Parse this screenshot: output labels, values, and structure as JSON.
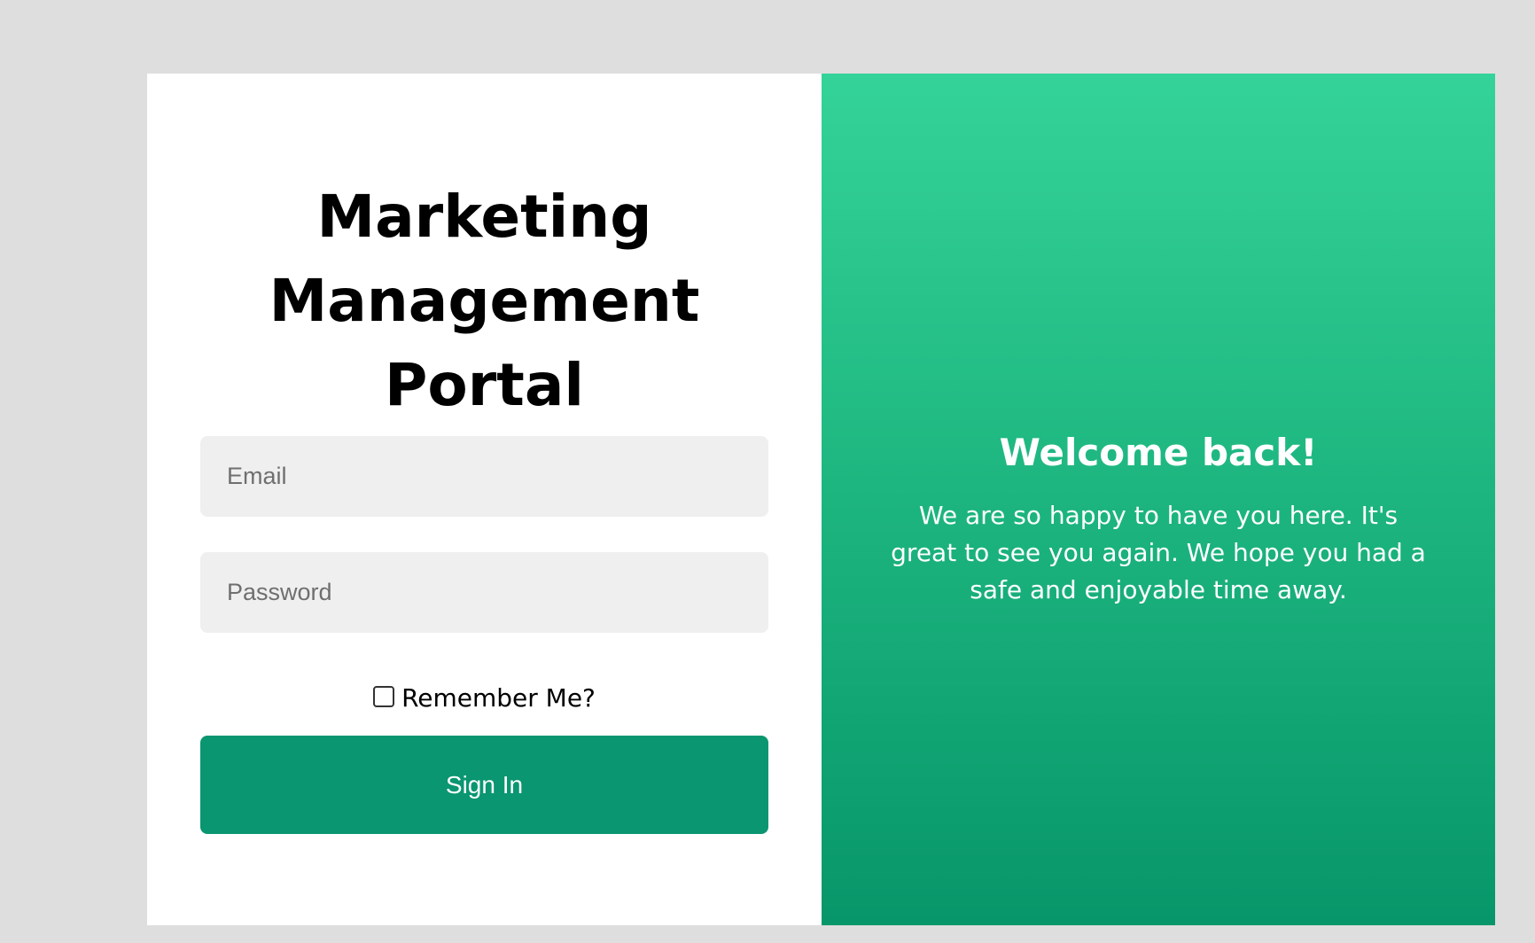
{
  "login": {
    "title_lines": [
      "Marketing",
      "Management",
      "Portal"
    ],
    "email_placeholder": "Email",
    "password_placeholder": "Password",
    "remember_label": "Remember Me?",
    "remember_checked": false,
    "signin_label": "Sign In"
  },
  "welcome_panel": {
    "heading": "Welcome back!",
    "message": "We are so happy to have you here. It's great to see you again. We hope you had a safe and enjoyable time away."
  },
  "colors": {
    "page_background": "#dedede",
    "button": "#099670",
    "panel_gradient_top": "#34d399",
    "panel_gradient_bottom": "#079669"
  }
}
